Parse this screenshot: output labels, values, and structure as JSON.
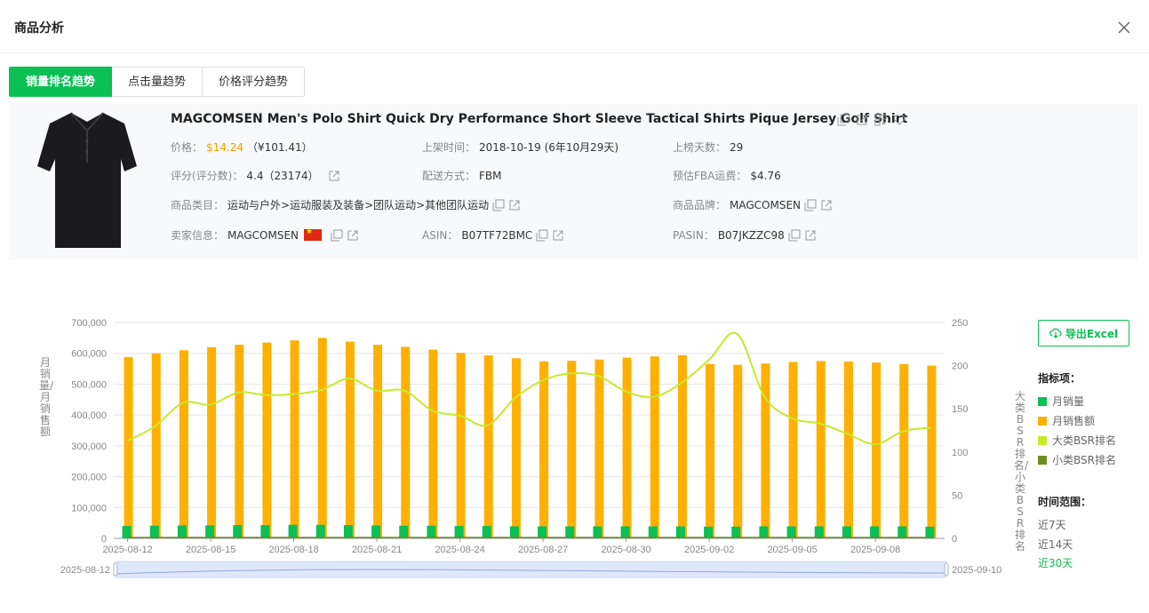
{
  "header": {
    "title": "商品分析"
  },
  "tabs": [
    "销量排名趋势",
    "点击量趋势",
    "价格评分趋势"
  ],
  "product": {
    "title": "MAGCOMSEN Men's Polo Shirt Quick Dry Performance Short Sleeve Tactical Shirts Pique Jersey Golf Shirt",
    "price_label": "价格：",
    "price": "$14.24",
    "price_cny": "（¥101.41）",
    "listed_label": "上架时间：",
    "listed": "2018-10-19 (6年10月29天)",
    "days_label": "上榜天数：",
    "days": "29",
    "rating_label": "评分(评分数)：",
    "rating": "4.4（23174）",
    "ship_label": "配送方式：",
    "ship": "FBM",
    "fba_label": "预估FBA运费：",
    "fba": "$4.76",
    "category_label": "商品类目：",
    "category": "运动与户外>运动服装及装备>团队运动>其他团队运动",
    "brand_label": "商品品牌：",
    "brand": "MAGCOMSEN",
    "seller_label": "卖家信息：",
    "seller": "MAGCOMSEN",
    "asin_label": "ASIN：",
    "asin": "B07TF72BMC",
    "pasin_label": "PASIN：",
    "pasin": "B07JKZZC98"
  },
  "side": {
    "excel": "导出Excel",
    "legend_title": "指标项：",
    "legend": [
      "月销量",
      "月销售额",
      "大类BSR排名",
      "小类BSR排名"
    ],
    "range_title": "时间范围：",
    "ranges": [
      "近7天",
      "近14天",
      "近30天"
    ]
  },
  "colors": {
    "accent": "#0bc054",
    "sales": "#0bc054",
    "revenue": "#ffb000",
    "bsr_main": "#c6ea2a",
    "bsr_sub": "#6b8e23"
  },
  "chart_data": {
    "type": "bar",
    "x": [
      "2025-08-12",
      "2025-08-13",
      "2025-08-14",
      "2025-08-15",
      "2025-08-16",
      "2025-08-17",
      "2025-08-18",
      "2025-08-19",
      "2025-08-20",
      "2025-08-21",
      "2025-08-22",
      "2025-08-23",
      "2025-08-24",
      "2025-08-25",
      "2025-08-26",
      "2025-08-27",
      "2025-08-28",
      "2025-08-29",
      "2025-08-30",
      "2025-08-31",
      "2025-09-01",
      "2025-09-02",
      "2025-09-03",
      "2025-09-04",
      "2025-09-05",
      "2025-09-06",
      "2025-09-07",
      "2025-09-08",
      "2025-09-09",
      "2025-09-10"
    ],
    "xticks": [
      "2025-08-12",
      "2025-08-15",
      "2025-08-18",
      "2025-08-21",
      "2025-08-24",
      "2025-08-27",
      "2025-08-30",
      "2025-09-02",
      "2025-09-05",
      "2025-09-08"
    ],
    "ylabel_left": "月销量/月销售额",
    "ylabel_right": "大类BSR排名/小类BSR排名",
    "yticks_left": [
      "0",
      "100,000",
      "200,000",
      "300,000",
      "400,000",
      "500,000",
      "600,000",
      "700,000"
    ],
    "yticks_right": [
      "0",
      "50",
      "100",
      "150",
      "200",
      "250"
    ],
    "ylim_left": [
      0,
      700000
    ],
    "ylim_right": [
      0,
      250
    ],
    "series": [
      {
        "name": "月销量",
        "type": "bar",
        "axis": "left",
        "values": [
          40000,
          41000,
          42000,
          42000,
          43000,
          43000,
          44000,
          44000,
          43000,
          42000,
          41000,
          41000,
          40000,
          40000,
          39000,
          39000,
          39000,
          39000,
          39000,
          39000,
          39000,
          38000,
          38000,
          39000,
          39000,
          39000,
          39000,
          39000,
          39000,
          38000
        ]
      },
      {
        "name": "月销售额",
        "type": "bar",
        "axis": "left",
        "values": [
          588000,
          600000,
          610000,
          620000,
          628000,
          635000,
          642000,
          650000,
          638000,
          628000,
          621000,
          612000,
          602000,
          593000,
          584000,
          574000,
          576000,
          580000,
          586000,
          590000,
          594000,
          565000,
          563000,
          567000,
          572000,
          575000,
          573000,
          570000,
          565000,
          560000
        ]
      },
      {
        "name": "大类BSR排名",
        "type": "line",
        "axis": "right",
        "values": [
          113,
          130,
          157,
          155,
          169,
          166,
          167,
          172,
          185,
          171,
          171,
          148,
          142,
          131,
          163,
          183,
          191,
          188,
          170,
          164,
          180,
          207,
          237,
          164,
          139,
          133,
          121,
          109,
          124,
          128
        ]
      },
      {
        "name": "小类BSR排名",
        "type": "line",
        "axis": "right",
        "values": [
          1,
          1,
          1,
          1,
          1,
          1,
          1,
          1,
          1,
          1,
          1,
          1,
          1,
          1,
          1,
          1,
          1,
          1,
          1,
          1,
          1,
          1,
          1,
          1,
          1,
          1,
          1,
          1,
          1,
          1
        ]
      }
    ],
    "zoom": {
      "start": "2025-08-12",
      "end": "2025-09-10"
    }
  }
}
